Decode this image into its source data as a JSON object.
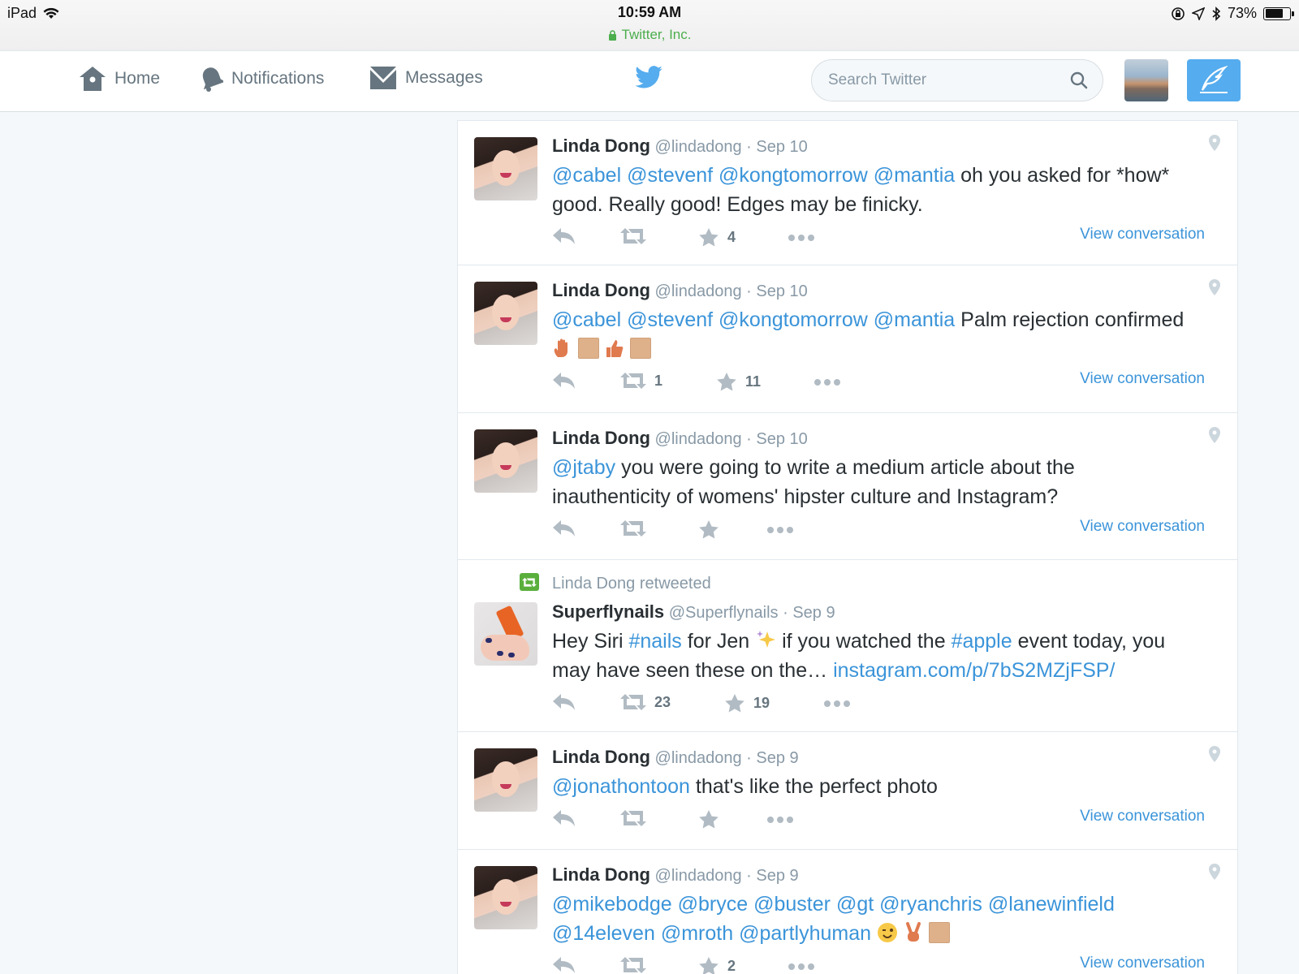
{
  "status_bar": {
    "device": "iPad",
    "time": "10:59 AM",
    "site": "Twitter, Inc.",
    "battery_text": "73%",
    "battery_level": 0.73
  },
  "nav": {
    "home": "Home",
    "notifications": "Notifications",
    "messages": "Messages",
    "search_placeholder": "Search Twitter"
  },
  "colors": {
    "accent": "#55acee",
    "link": "#3b94d9",
    "retweet": "#5aaf3c"
  },
  "tweets": [
    {
      "name": "Linda Dong",
      "handle": "@lindadong",
      "sep": "·",
      "date": "Sep 10",
      "mentions": [
        "@cabel",
        "@stevenf",
        "@kongtomorrow",
        "@mantia"
      ],
      "text": "oh you asked for *how* good. Really good! Edges may be finicky.",
      "retweets": "",
      "favorites": "4",
      "view": "View conversation"
    },
    {
      "name": "Linda Dong",
      "handle": "@lindadong",
      "sep": "·",
      "date": "Sep 10",
      "mentions": [
        "@cabel",
        "@stevenf",
        "@kongtomorrow",
        "@mantia"
      ],
      "text": "Palm rejection confirmed",
      "emoji": [
        "raised-hand",
        "square",
        "thumbs-up",
        "square"
      ],
      "retweets": "1",
      "favorites": "11",
      "view": "View conversation"
    },
    {
      "name": "Linda Dong",
      "handle": "@lindadong",
      "sep": "·",
      "date": "Sep 10",
      "mentions": [
        "@jtaby"
      ],
      "text": "you were going to write a medium article about the inauthenticity of womens' hipster culture and Instagram?",
      "retweets": "",
      "favorites": "",
      "view": "View conversation"
    },
    {
      "retweeted_by": "Linda Dong retweeted",
      "name": "Superflynails",
      "handle": "@Superflynails",
      "sep": "·",
      "date": "Sep 9",
      "text_a": "Hey Siri",
      "hashtag1": "#nails",
      "text_b": "for Jen",
      "text_c": "if you watched the",
      "hashtag2": "#apple",
      "text_d": "event today, you may have seen these on the…",
      "url": "instagram.com/p/7bS2MZjFSP/",
      "retweets": "23",
      "favorites": "19"
    },
    {
      "name": "Linda Dong",
      "handle": "@lindadong",
      "sep": "·",
      "date": "Sep 9",
      "mentions": [
        "@jonathontoon"
      ],
      "text": "that's like the perfect photo",
      "retweets": "",
      "favorites": "",
      "view": "View conversation"
    },
    {
      "name": "Linda Dong",
      "handle": "@lindadong",
      "sep": "·",
      "date": "Sep 9",
      "mentions": [
        "@mikebodge",
        "@bryce",
        "@buster",
        "@gt",
        "@ryanchris",
        "@lanewinfield",
        "@14eleven",
        "@mroth",
        "@partlyhuman"
      ],
      "retweets": "",
      "favorites": "2",
      "view": "View conversation"
    }
  ]
}
